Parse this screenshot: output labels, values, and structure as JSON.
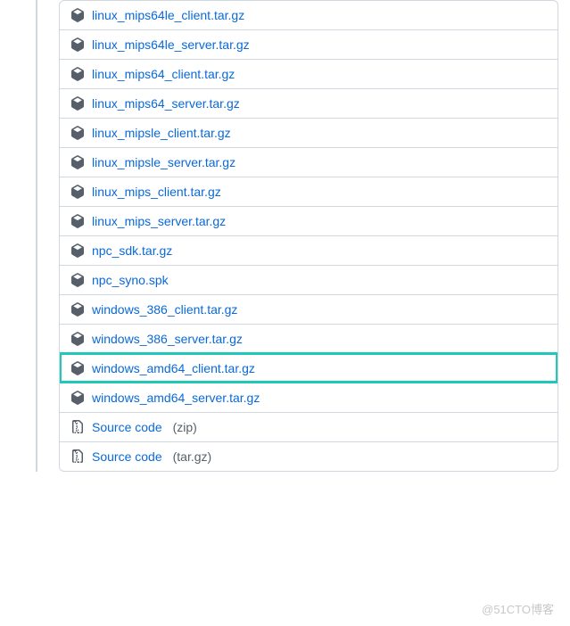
{
  "assets": [
    {
      "name": "linux_mips64le_client.tar.gz",
      "type": "package",
      "highlighted": false
    },
    {
      "name": "linux_mips64le_server.tar.gz",
      "type": "package",
      "highlighted": false
    },
    {
      "name": "linux_mips64_client.tar.gz",
      "type": "package",
      "highlighted": false
    },
    {
      "name": "linux_mips64_server.tar.gz",
      "type": "package",
      "highlighted": false
    },
    {
      "name": "linux_mipsle_client.tar.gz",
      "type": "package",
      "highlighted": false
    },
    {
      "name": "linux_mipsle_server.tar.gz",
      "type": "package",
      "highlighted": false
    },
    {
      "name": "linux_mips_client.tar.gz",
      "type": "package",
      "highlighted": false
    },
    {
      "name": "linux_mips_server.tar.gz",
      "type": "package",
      "highlighted": false
    },
    {
      "name": "npc_sdk.tar.gz",
      "type": "package",
      "highlighted": false
    },
    {
      "name": "npc_syno.spk",
      "type": "package",
      "highlighted": false
    },
    {
      "name": "windows_386_client.tar.gz",
      "type": "package",
      "highlighted": false
    },
    {
      "name": "windows_386_server.tar.gz",
      "type": "package",
      "highlighted": false
    },
    {
      "name": "windows_amd64_client.tar.gz",
      "type": "package",
      "highlighted": true
    },
    {
      "name": "windows_amd64_server.tar.gz",
      "type": "package",
      "highlighted": false
    },
    {
      "name": "Source code",
      "format": "(zip)",
      "type": "source",
      "highlighted": false
    },
    {
      "name": "Source code",
      "format": "(tar.gz)",
      "type": "source",
      "highlighted": false
    }
  ],
  "watermark": "@51CTO博客"
}
